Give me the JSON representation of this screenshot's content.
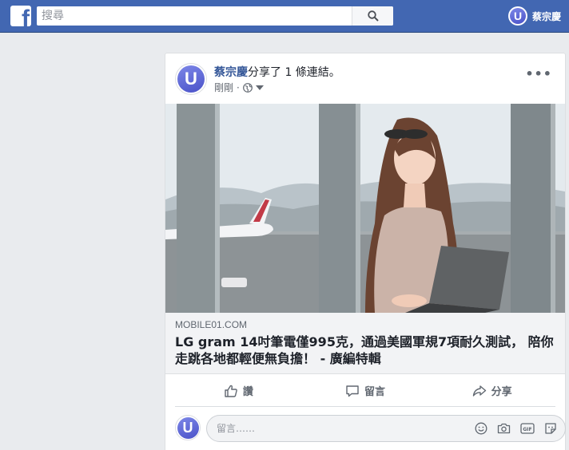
{
  "topbar": {
    "logo_letter": "f",
    "search_placeholder": "搜尋",
    "user_name": "蔡宗慶",
    "avatar_letter": "U"
  },
  "post": {
    "author": "蔡宗慶",
    "action_text": "分享了 1 條連結。",
    "time": "剛剛",
    "separator": "·",
    "more": "•••",
    "avatar_letter": "U"
  },
  "link": {
    "domain": "MOBILE01.COM",
    "title": "LG gram 14吋筆電僅995克，通過美國軍規7項耐久測試， 陪你走跳各地都輕便無負擔！ - 廣編特輯"
  },
  "actions": {
    "like": "讚",
    "comment": "留言",
    "share": "分享"
  },
  "comment": {
    "placeholder": "留言……",
    "avatar_letter": "U"
  },
  "colors": {
    "topbar": "#4267b2",
    "link_author": "#365899",
    "page_bg": "#e9ebee"
  }
}
